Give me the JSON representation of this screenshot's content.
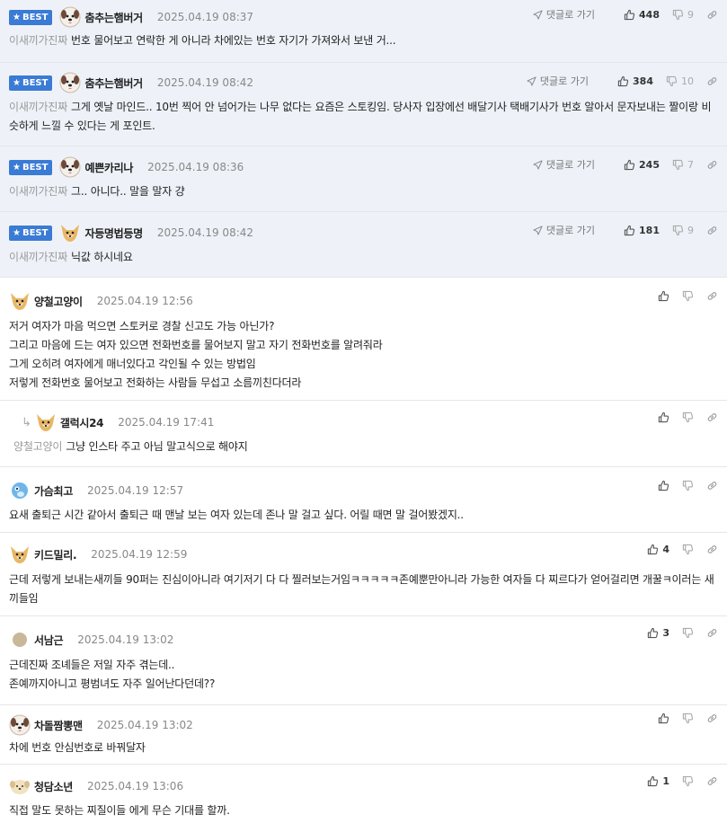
{
  "best_label": "BEST",
  "reply_link_label": "댓글로 가기",
  "comments": [
    {
      "nick": "춤추는햄버거",
      "date": "2025.04.19 08:37",
      "mention": "이새끼가진짜",
      "text": "번호 물어보고 연락한 게 아니라 차에있는 번호 자기가 가져와서 보낸 거...",
      "likes": "448",
      "dislikes": "9"
    },
    {
      "nick": "춤추는햄버거",
      "date": "2025.04.19 08:42",
      "mention": "이새끼가진짜",
      "text": "그게 옛날 마인드.. 10번 찍어 안 넘어가는 나무 없다는 요즘은 스토킹임. 당사자 입장에선 배달기사 택배기사가 번호 알아서 문자보내는 짤이랑 비슷하게 느낄 수 있다는 게 포인트.",
      "likes": "384",
      "dislikes": "10"
    },
    {
      "nick": "예쁜카리나",
      "date": "2025.04.19 08:36",
      "mention": "이새끼가진짜",
      "text": "그.. 아니다.. 말을 말자 걍",
      "likes": "245",
      "dislikes": "7"
    },
    {
      "nick": "자등명법등명",
      "date": "2025.04.19 08:42",
      "mention": "이새끼가진짜",
      "text": "닉값 하시네요",
      "likes": "181",
      "dislikes": "9"
    },
    {
      "nick": "양철고양이",
      "date": "2025.04.19 12:56",
      "lines": [
        "저거 여자가 마음 먹으면 스토커로 경찰 신고도 가능 아닌가?",
        "그리고 마음에 드는 여자 있으면 전화번호를 물어보지 말고 자기 전화번호를 알려줘라",
        "그게 오히려 여자에게 매너있다고 각인될 수 있는 방법임",
        "저렇게 전화번호 물어보고 전화하는 사람들 무섭고 소름끼친다더라"
      ]
    },
    {
      "nick": "갤럭시24",
      "date": "2025.04.19 17:41",
      "mention": "양철고양이",
      "text": "그냥 인스타 주고 아님 말고식으로 해야지"
    },
    {
      "nick": "가슴최고",
      "date": "2025.04.19 12:57",
      "text": "요새 출퇴근 시간 같아서 출퇴근 때 맨날 보는 여자 있는데 존나 말 걸고 싶다. 어릴 때면 말 걸어봤겠지.."
    },
    {
      "nick": "키드밀리.",
      "date": "2025.04.19 12:59",
      "text": "근데 저렇게 보내는새끼들 90퍼는 진심이아니라 여기저기 다 다 찔러보는거임ㅋㅋㅋㅋㅋ존예뿐만아니라 가능한 여자들 다 찌르다가 얻어걸리면 개꿀ㅋ이러는 새끼들임",
      "likes": "4"
    },
    {
      "nick": "서남근",
      "date": "2025.04.19 13:02",
      "lines": [
        "근데진짜 조녜들은 저일 자주 겪는데..",
        "존예까지아니고 평범녀도 자주 일어난다던데??"
      ],
      "likes": "3"
    },
    {
      "nick": "차돌짬뽕맨",
      "date": "2025.04.19 13:02",
      "text": "차에 번호 안심번호로 바꿔달자"
    },
    {
      "nick": "청담소년",
      "date": "2025.04.19 13:06",
      "text": "직접 말도 못하는 찌질이들 에게 무슨 기대를 할까.",
      "likes": "1"
    }
  ]
}
